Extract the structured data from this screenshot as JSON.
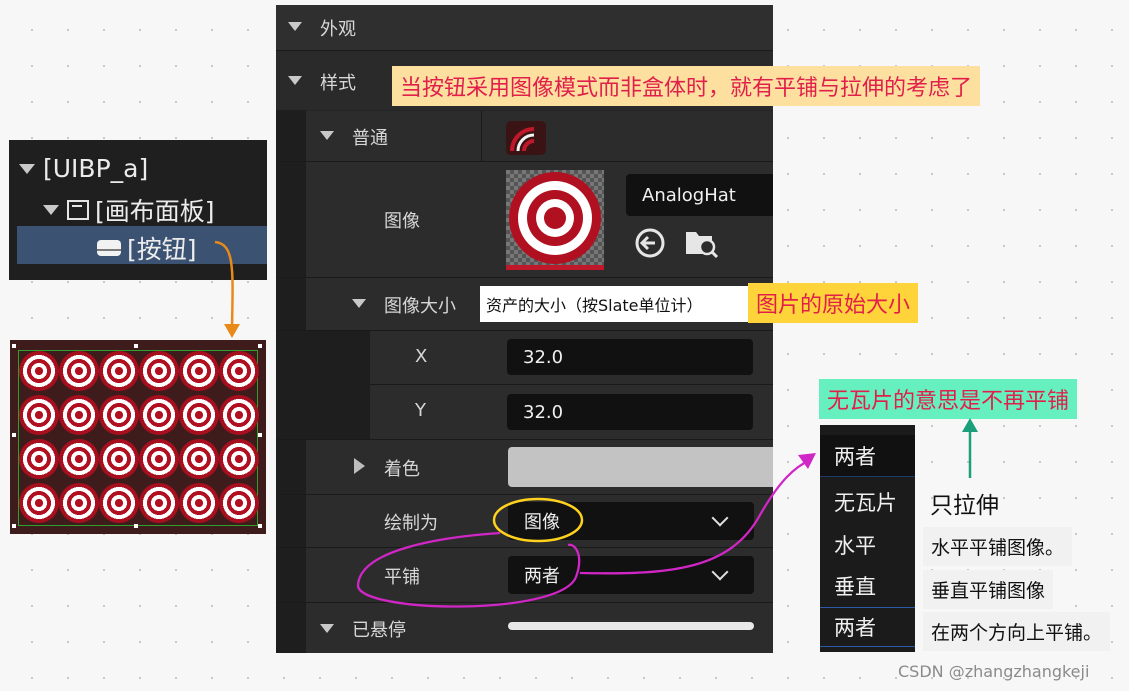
{
  "hierarchy": {
    "root": "[UIBP_a]",
    "canvas": "[画布面板]",
    "button": "[按钮]"
  },
  "details": {
    "appearance": "外观",
    "style": "样式",
    "normal": "普通",
    "image_label": "图像",
    "asset_name": "AnalogHat",
    "image_size_label": "图像大小",
    "image_size_tooltip": "资产的大小（按Slate单位计）",
    "x_label": "X",
    "x_value": "32.0",
    "y_label": "Y",
    "y_value": "32.0",
    "tint_label": "着色",
    "draw_as_label": "绘制为",
    "draw_as_value": "图像",
    "tiling_label": "平铺",
    "tiling_value": "两者",
    "hovered_label": "已悬停"
  },
  "annotations": {
    "style_note": "当按钮采用图像模式而非盒体时，就有平铺与拉伸的考虑了",
    "size_note": "图片的原始大小",
    "no_tile_note": "无瓦片的意思是不再平铺",
    "stretch_only": "只拉伸",
    "horizontal_desc": "水平平铺图像。",
    "vertical_desc": "垂直平铺图像",
    "both_desc": "在两个方向上平铺。"
  },
  "tiling_dropdown": {
    "current": "两者",
    "options": [
      "无瓦片",
      "水平",
      "垂直",
      "两者"
    ]
  },
  "watermark": "CSDN @zhangzhangkeji",
  "colors": {
    "panel_bg": "#242424",
    "note_orange_bg": "#fde0a0",
    "note_orange_text": "#e0204a",
    "note_yellow_bg": "#ffd43a",
    "note_green_bg": "#66f0c0",
    "target_red": "#b01020",
    "annotation_orange": "#e88a1a",
    "annotation_magenta": "#d126c6",
    "annotation_teal": "#1b9e7a"
  }
}
